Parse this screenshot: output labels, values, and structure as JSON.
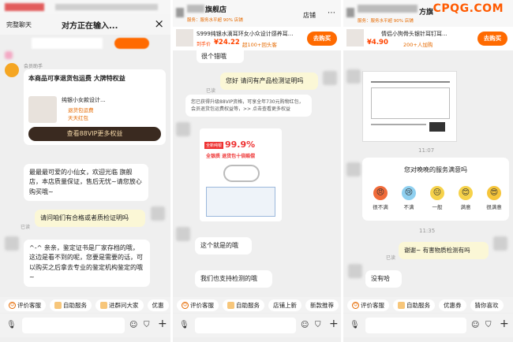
{
  "watermark": "CPQG.COM",
  "panel1": {
    "topbar": "日常婚嫁帕帕",
    "title": "对方正在输入...",
    "left_label": "完整聊天",
    "close": "×",
    "helper_name": "会员助手",
    "promo_title": "本商品可享退货包运费 大牌特权益",
    "product_line1": "纯银小女款设计...",
    "product_line2": "退货包运费",
    "product_line3": "天天红包",
    "vip_button": "查看88VIP更多权益",
    "msg1": "最最最可爱的小仙女，欢迎光临 旗舰店，本店质量保证，售后无忧~请您放心购买哦~",
    "msg2": "请问咱们有合格或者质检证明吗",
    "read": "已读",
    "msg3": "^-^ 亲亲，鉴定证书是厂家存档的哦，这边是看不到的呢，您要是需要的话，可以购买之后拿去专业的鉴定机构鉴定的哦~",
    "toolbar": [
      "评价客服",
      "自助服务",
      "进群问大家",
      "优惠"
    ]
  },
  "panel2": {
    "shop": "旗舰店",
    "shop_rating": "服务：服务水平超 90% 店铺",
    "store_btn": "店铺",
    "product_title": "S999纯银水滴耳环女小众设计感养耳...",
    "price_label": "到手价",
    "price": "¥24.22",
    "sales": "超100+回头客",
    "buy": "去购买",
    "msg0": "很个错哦",
    "msg1": "您好 请问有产品检测证明吗",
    "read": "已读",
    "vip_text": "您已获得升级88VIP资格，可享全年730元购物红包，会员退货包运费权益等，>> 点击查看更多权益",
    "cert_pct": "99.9%",
    "cert_tag": "全新纯银",
    "cert_sub": "全银质 退货包十倍赔偿",
    "msg2": "这个就是的哦",
    "msg3": "我们也支持检测的哦",
    "toolbar": [
      "评价客服",
      "自助服务",
      "店铺上新",
      "新款推荐"
    ]
  },
  "panel3": {
    "shop": "方旗",
    "shop_rating": "服务：服务水平超 90% 店铺",
    "store_btn": "店铺",
    "product_title": "情侣小狗骨头银针耳钉耳...",
    "price": "¥4.90",
    "sales": "200+人加购",
    "buy": "去购买",
    "time1": "11:07",
    "survey": "您对晚晚的服务满意吗",
    "emojis": [
      "很不满",
      "不满",
      "一般",
      "满意",
      "很满意"
    ],
    "time2": "11:35",
    "msg1": "谢谢~ 有害物质检测有吗",
    "read": "已读",
    "msg2": "没有哈",
    "toolbar": [
      "评价客服",
      "自助服务",
      "优惠券",
      "猜你喜欢"
    ]
  }
}
